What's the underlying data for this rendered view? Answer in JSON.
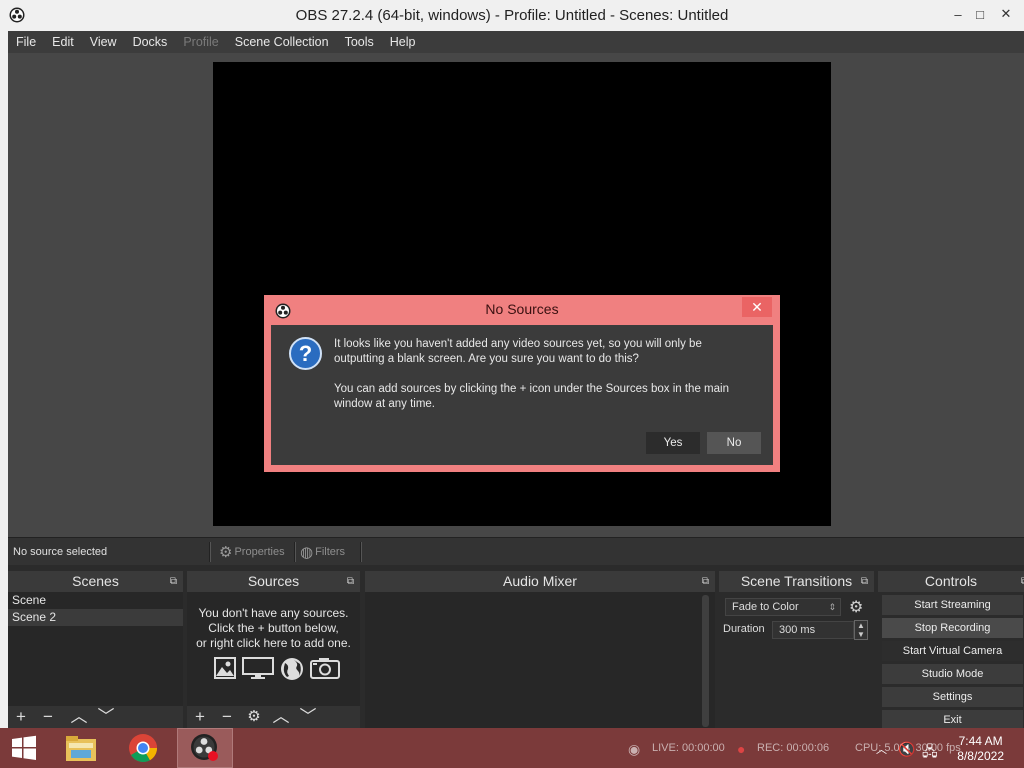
{
  "window": {
    "title": "OBS 27.2.4 (64-bit, windows) - Profile: Untitled - Scenes: Untitled",
    "minimize": "–",
    "maximize": "□",
    "close": "✕"
  },
  "menu": {
    "items": [
      {
        "label": "File"
      },
      {
        "label": "Edit"
      },
      {
        "label": "View"
      },
      {
        "label": "Docks"
      },
      {
        "label": "Profile",
        "disabled": true
      },
      {
        "label": "Scene Collection"
      },
      {
        "label": "Tools"
      },
      {
        "label": "Help"
      }
    ]
  },
  "source_toolbar": {
    "status": "No source selected",
    "properties": "Properties",
    "filters": "Filters"
  },
  "scenes": {
    "title": "Scenes",
    "items": [
      "Scene",
      "Scene 2"
    ],
    "selected_index": 1
  },
  "sources": {
    "title": "Sources",
    "empty_line1": "You don't have any sources.",
    "empty_line2": "Click the + button below,",
    "empty_line3": "or right click here to add one."
  },
  "audio_mixer": {
    "title": "Audio Mixer"
  },
  "transitions": {
    "title": "Scene Transitions",
    "selected": "Fade to Color",
    "duration_label": "Duration",
    "duration_value": "300 ms"
  },
  "controls": {
    "title": "Controls",
    "start_streaming": "Start Streaming",
    "stop_recording": "Stop Recording",
    "start_virtual_camera": "Start Virtual Camera",
    "studio_mode": "Studio Mode",
    "settings": "Settings",
    "exit": "Exit"
  },
  "dialog": {
    "title": "No Sources",
    "close": "✕",
    "line1": "It looks like you haven't added any video sources yet, so you will only be outputting a blank screen. Are you sure you want to do this?",
    "line2": "You can add sources by clicking the + icon under the Sources box in the main window at any time.",
    "yes": "Yes",
    "no": "No"
  },
  "statusbar": {
    "live": "LIVE: 00:00:00",
    "rec": "REC: 00:00:06",
    "cpu": "CPU: 5.0%, 30.00 fps"
  },
  "taskbar": {
    "time": "7:44 AM",
    "date": "8/8/2022"
  },
  "colors": {
    "dialog_border": "#f08080",
    "taskbar": "#7b3a3a",
    "panel": "#272727"
  }
}
